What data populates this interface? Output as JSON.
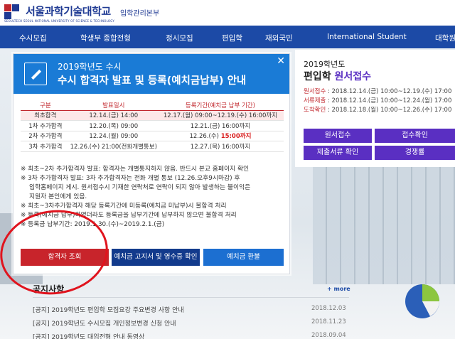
{
  "header": {
    "logo_kr": "서울과학기술대학교",
    "logo_en": "SEOULTECH  SEOUL NATIONAL UNIVERSITY OF SCIENCE & TECHNOLOGY",
    "logo_sub": "입학관리본부"
  },
  "nav": [
    "수시모집",
    "학생부 종합전형",
    "정시모집",
    "편입학",
    "재외국민",
    "International Student",
    "대학원"
  ],
  "popup": {
    "subtitle": "2019학년도 수시",
    "title": "수시 합격자 발표 및 등록(예치금납부) 안내",
    "close": "✕",
    "table_headers": [
      "구분",
      "발표일시",
      "등록기간(예치금 납부 기간)"
    ],
    "rows": [
      [
        "최초합격",
        "12.14.(금) 14:00",
        "12.17.(월) 09:00~12.19.(수) 16:00까지"
      ],
      [
        "1차 추가합격",
        "12.20.(목) 09:00",
        "12.21.(금) 16:00까지"
      ],
      [
        "2차 추가합격",
        "12.24.(월) 09:00",
        "12.26.(수) ",
        "15:00까지"
      ],
      [
        "3차 추가합격",
        "12.26.(수) 21:00(전화개별통보)",
        "12.27.(목) 16:00까지"
      ]
    ],
    "notes": [
      "※ 최초~2차 추가합격자 발표: 합격자는 개별통지하지 않음. 반드시 본교 홈페이지 확인",
      "※ 3차 추가합격자 발표: 3차 추가합격자는 전화 개별 통보 (12.26.오후9시마감) 후",
      "입학홈페이지 게시. 원서접수시 기재한 연락처로 연락이 되지 않아 발생하는 불이익은",
      "지원자 본인에게 있음.",
      "※ 최초~3차추가합격자 해당 등록기간에 미등록(예치금 미납부)시 불합격 처리",
      "※ 등록(예치금 납부)하였더라도 등록금을 납부기간에 납부하지 않으면 불합격 처리",
      "※ 등록금 납부기간: 2019.1.30.(수)~2019.2.1.(금)"
    ],
    "buttons": {
      "result": "합격자 조회",
      "receipt": "예치금 고지서 및 영수증 확인",
      "refund": "예치금 환불"
    }
  },
  "right_panel": {
    "year": "2019학년도",
    "title_a": "편입학 ",
    "title_b": "원서접수",
    "items": [
      {
        "k": "원서접수",
        "v": " : 2018.12.14.(금) 10:00~12.19.(수) 17:00"
      },
      {
        "k": "서류제출",
        "v": " : 2018.12.14.(금) 10:00~12.24.(월) 17:00"
      },
      {
        "k": "도착확인",
        "v": " : 2018.12.18.(월) 10:00~12.26.(수) 17:00"
      }
    ],
    "buttons": [
      "원서접수",
      "접수확인",
      "제출서류 확인",
      "경쟁률"
    ]
  },
  "notice": {
    "title": "공지사항",
    "more": "+ more",
    "items": [
      {
        "text": "[공지] 2019학년도 편입학 모집요강 주요변경 사항 안내",
        "date": "2018.12.03"
      },
      {
        "text": "[공지] 2019학년도 수시모집 개인정보변경 신청 안내",
        "date": "2018.11.23"
      },
      {
        "text": "[공지] 2019학년도 대입전형 안내 동영상",
        "date": "2018.09.04"
      }
    ]
  },
  "colors": {
    "nav_bg": "#1c4aa6",
    "popup_head": "#1a7bd6",
    "btn_red": "#c8242b",
    "btn_navy": "#123a8c",
    "btn_blue": "#1c6fd1",
    "purple": "#5a2fc2",
    "annotation": "#e0141e"
  }
}
